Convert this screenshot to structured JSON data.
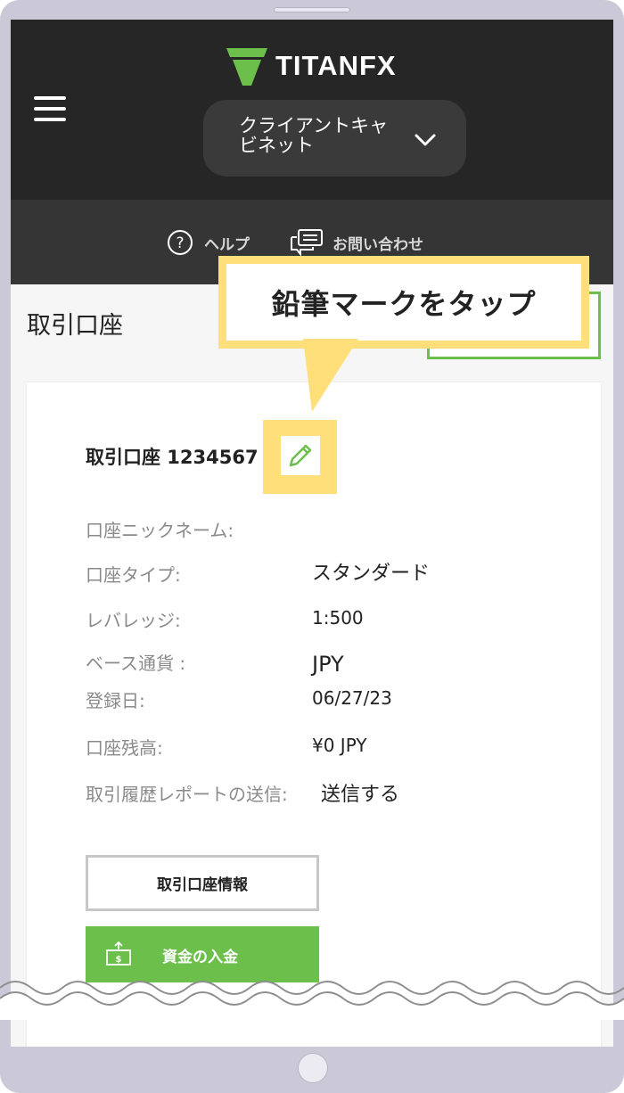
{
  "header": {
    "brand": "TITANFX",
    "client_cabinet": "クライアントキャビネット",
    "help": "ヘルプ",
    "contact": "お問い合わせ"
  },
  "page": {
    "title": "取引口座"
  },
  "account": {
    "title": "取引口座 1234567",
    "rows": [
      {
        "label": "口座ニックネーム:",
        "value": ""
      },
      {
        "label": "口座タイプ:",
        "value": "スタンダード"
      },
      {
        "label": "レバレッジ:",
        "value": "1:500"
      },
      {
        "label": "ベース通貨 :",
        "value": "JPY"
      },
      {
        "label": "登録日:",
        "value": "06/27/23"
      },
      {
        "label": "口座残高:",
        "value": "¥0 JPY"
      },
      {
        "label": "取引履歴レポートの送信:",
        "value": "送信する"
      }
    ],
    "info_button": "取引口座情報",
    "deposit_button": "資金の入金"
  },
  "callout": {
    "text": "鉛筆マークをタップ"
  },
  "colors": {
    "header_bg": "#262626",
    "accent_green": "#6cbf4b",
    "highlight_yellow": "#ffdf7a"
  }
}
